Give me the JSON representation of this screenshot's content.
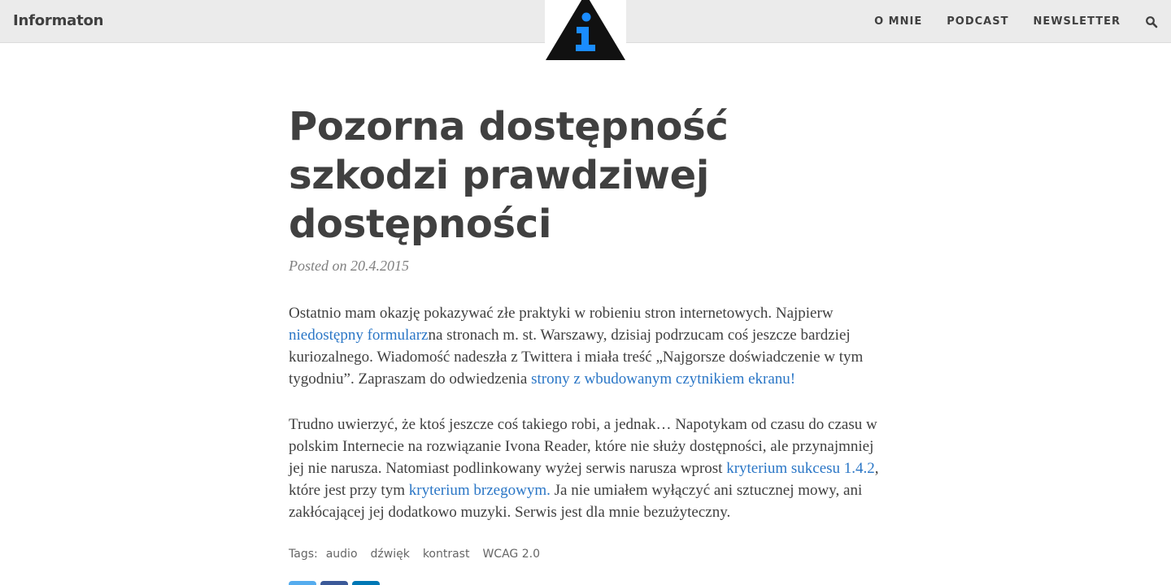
{
  "nav": {
    "brand": "Informaton",
    "links": [
      "O MNIE",
      "PODCAST",
      "NEWSLETTER"
    ]
  },
  "icons": {
    "logo": "info-triangle-logo",
    "search": "search-icon"
  },
  "colors": {
    "link": "#2a76c6",
    "navbar": "#ebebeb",
    "logo_blue": "#1a8cff"
  },
  "post": {
    "title": "Pozorna dostępność szkodzi prawdziwej dostępności",
    "meta": "Posted on 20.4.2015",
    "p1": {
      "t1": "Ostatnio mam okazję pokazywać złe praktyki w robieniu stron internetowych. Najpierw ",
      "link1": "niedostępny formularz",
      "t2": "na stronach m. st. Warszawy, dzisiaj podrzucam coś jeszcze bardziej kuriozalnego. Wiadomość nadeszła z Twittera i miała treść „Najgorsze doświadczenie w tym tygodniu”. Zapraszam do odwiedzenia ",
      "link2": "strony z wbudowanym czytnikiem ekranu!"
    },
    "p2": {
      "t1": "Trudno uwierzyć, że ktoś jeszcze coś takiego robi, a jednak… Napotykam od czasu do czasu w polskim Internecie na rozwiązanie Ivona Reader, które nie służy dostępności, ale przynajmniej jej nie narusza. Natomiast podlinkowany wyżej serwis narusza wprost ",
      "link1": "kryterium sukcesu 1.4.2",
      "t2": ", które jest przy tym ",
      "link2": "kryterium brzegowym.",
      "t3": " Ja nie umiałem wyłączyć ani sztucznej mowy, ani zakłócającej jej dodatkowo muzyki. Serwis jest dla mnie bezużyteczny."
    },
    "tags_label": "Tags:",
    "tags": [
      "audio",
      "dźwięk",
      "kontrast",
      "WCAG 2.0"
    ]
  },
  "share_buttons": [
    {
      "name": "twitter-share-button",
      "color": "#55acee"
    },
    {
      "name": "facebook-share-button",
      "color": "#3b5998"
    },
    {
      "name": "linkedin-share-button",
      "color": "#0077b5"
    }
  ]
}
